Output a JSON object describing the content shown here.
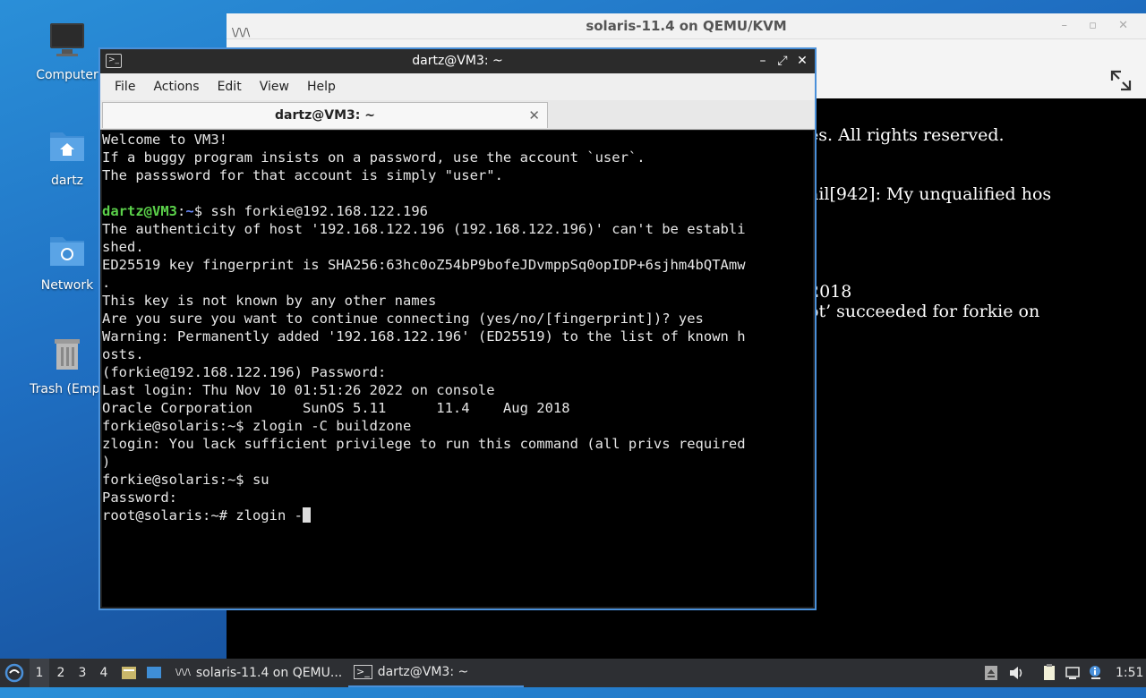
{
  "desktop": {
    "icons": [
      {
        "label": "Computer"
      },
      {
        "label": "dartz"
      },
      {
        "label": "Network"
      },
      {
        "label": "Trash (Empt"
      }
    ]
  },
  "qemu": {
    "title": "solaris-11.4 on QEMU/KVM",
    "console_lines": [
      "es. All rights reserved.",
      "ail[942]: My unqualified hos",
      "2018",
      "ot’ succeeded for forkie on"
    ]
  },
  "terminal": {
    "title": "dartz@VM3: ~",
    "menu": [
      "File",
      "Actions",
      "Edit",
      "View",
      "Help"
    ],
    "tab_label": "dartz@VM3: ~",
    "prompt_user": "dartz@VM3",
    "prompt_sep": ":",
    "prompt_path": "~",
    "prompt_cmd": "$ ssh forkie@192.168.122.196",
    "lines_before": [
      "Welcome to VM3!",
      "If a buggy program insists on a password, use the account `user`.",
      "The passsword for that account is simply \"user\".",
      ""
    ],
    "lines_after": [
      "The authenticity of host '192.168.122.196 (192.168.122.196)' can't be establi",
      "shed.",
      "ED25519 key fingerprint is SHA256:63hc0oZ54bP9bofeJDvmppSq0opIDP+6sjhm4bQTAmw",
      ".",
      "This key is not known by any other names",
      "Are you sure you want to continue connecting (yes/no/[fingerprint])? yes",
      "Warning: Permanently added '192.168.122.196' (ED25519) to the list of known h",
      "osts.",
      "(forkie@192.168.122.196) Password:",
      "Last login: Thu Nov 10 01:51:26 2022 on console",
      "Oracle Corporation      SunOS 5.11      11.4    Aug 2018",
      "forkie@solaris:~$ zlogin -C buildzone",
      "zlogin: You lack sufficient privilege to run this command (all privs required",
      ")",
      "forkie@solaris:~$ su",
      "Password:"
    ],
    "current_input": "root@solaris:~# zlogin -"
  },
  "taskbar": {
    "workspaces": [
      "1",
      "2",
      "3",
      "4"
    ],
    "tasks": [
      {
        "label": "solaris-11.4 on QEMU..."
      },
      {
        "label": "dartz@VM3: ~"
      }
    ],
    "clock": "1:51"
  },
  "colors": {
    "accent": "#4a90d9",
    "prompt_green": "#5bd14a",
    "prompt_blue": "#6b8cff"
  }
}
